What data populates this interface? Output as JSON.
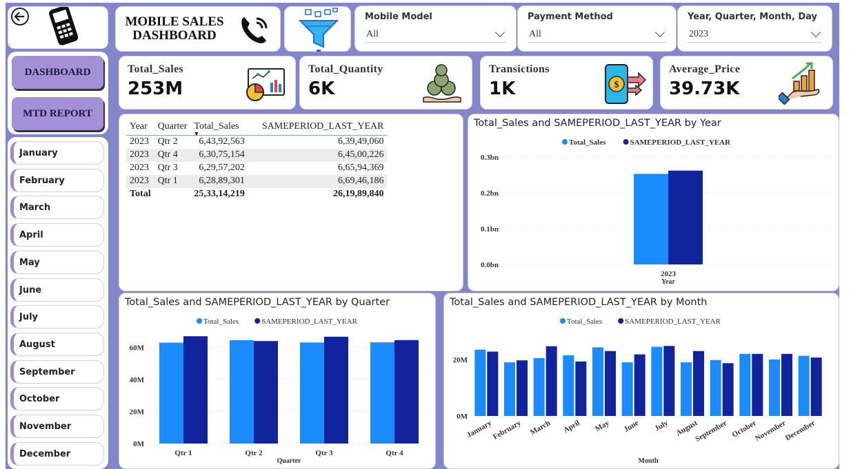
{
  "header": {
    "title_line1": "MOBILE SALES",
    "title_line2": "DASHBOARD"
  },
  "slicers": [
    {
      "label": "Mobile Model",
      "value": "All"
    },
    {
      "label": "Payment Method",
      "value": "All"
    },
    {
      "label": "Year, Quarter, Month, Day",
      "value": "2023"
    }
  ],
  "nav": {
    "dashboard": "DASHBOARD",
    "mtd_report": "MTD REPORT"
  },
  "months": [
    "January",
    "February",
    "March",
    "April",
    "May",
    "June",
    "July",
    "August",
    "September",
    "October",
    "November",
    "December"
  ],
  "kpis": [
    {
      "title": "Total_Sales",
      "value": "253M",
      "icon": "sales-report-icon"
    },
    {
      "title": "Total_Quantity",
      "value": "6K",
      "icon": "money-bags-icon"
    },
    {
      "title": "Transictions",
      "value": "1K",
      "icon": "mobile-payment-icon"
    },
    {
      "title": "Average_Price",
      "value": "39.73K",
      "icon": "growth-hand-icon"
    }
  ],
  "matrix": {
    "headers": [
      "Year",
      "Quarter",
      "Total_Sales",
      "SAMEPERIOD_LAST_YEAR"
    ],
    "rows": [
      {
        "year": "2023",
        "quarter": "Qtr 2",
        "sales": "6,43,92,563",
        "last": "6,39,49,060"
      },
      {
        "year": "2023",
        "quarter": "Qtr 4",
        "sales": "6,30,75,154",
        "last": "6,45,00,226"
      },
      {
        "year": "2023",
        "quarter": "Qtr 3",
        "sales": "6,29,57,202",
        "last": "6,65,94,369"
      },
      {
        "year": "2023",
        "quarter": "Qtr 1",
        "sales": "6,28,89,301",
        "last": "6,69,46,186"
      }
    ],
    "total": {
      "label": "Total",
      "sales": "25,33,14,219",
      "last": "26,19,89,840"
    }
  },
  "colors": {
    "total_sales": "#1a8cff",
    "last_year": "#12239e"
  },
  "chart_data": [
    {
      "type": "bar",
      "title": "Total_Sales and SAMEPERIOD_LAST_YEAR by Year",
      "categories": [
        "2023"
      ],
      "xlabel": "Year",
      "ylabel": "",
      "ylim": [
        0,
        0.3
      ],
      "yticks": [
        "0.0bn",
        "0.1bn",
        "0.2bn",
        "0.3bn"
      ],
      "legend": "top-center",
      "series": [
        {
          "name": "Total_Sales",
          "values": [
            0.253
          ]
        },
        {
          "name": "SAMEPERIOD_LAST_YEAR",
          "values": [
            0.262
          ]
        }
      ]
    },
    {
      "type": "bar",
      "title": "Total_Sales and SAMEPERIOD_LAST_YEAR by Quarter",
      "categories": [
        "Qtr 1",
        "Qtr 2",
        "Qtr 3",
        "Qtr 4"
      ],
      "xlabel": "Quarter",
      "ylabel": "",
      "ylim": [
        0,
        70
      ],
      "yticks": [
        "0M",
        "20M",
        "40M",
        "60M"
      ],
      "legend": "top-center",
      "series": [
        {
          "name": "Total_Sales",
          "values": [
            62.9,
            64.4,
            63.0,
            63.1
          ]
        },
        {
          "name": "SAMEPERIOD_LAST_YEAR",
          "values": [
            66.9,
            63.9,
            66.6,
            64.5
          ]
        }
      ]
    },
    {
      "type": "bar",
      "title": "Total_Sales and SAMEPERIOD_LAST_YEAR by Month",
      "categories": [
        "January",
        "February",
        "March",
        "April",
        "May",
        "June",
        "July",
        "August",
        "September",
        "October",
        "November",
        "December"
      ],
      "xlabel": "Month",
      "ylabel": "",
      "ylim": [
        0,
        30
      ],
      "yticks": [
        "0M",
        "20M"
      ],
      "legend": "top-center",
      "series": [
        {
          "name": "Total_Sales",
          "values": [
            23.5,
            19.0,
            20.5,
            21.5,
            24.3,
            19.0,
            24.5,
            19.0,
            19.8,
            22.0,
            20.0,
            21.3
          ]
        },
        {
          "name": "SAMEPERIOD_LAST_YEAR",
          "values": [
            22.8,
            19.7,
            24.7,
            19.3,
            23.0,
            21.8,
            24.8,
            23.0,
            18.7,
            22.0,
            22.0,
            20.7
          ]
        }
      ]
    }
  ]
}
